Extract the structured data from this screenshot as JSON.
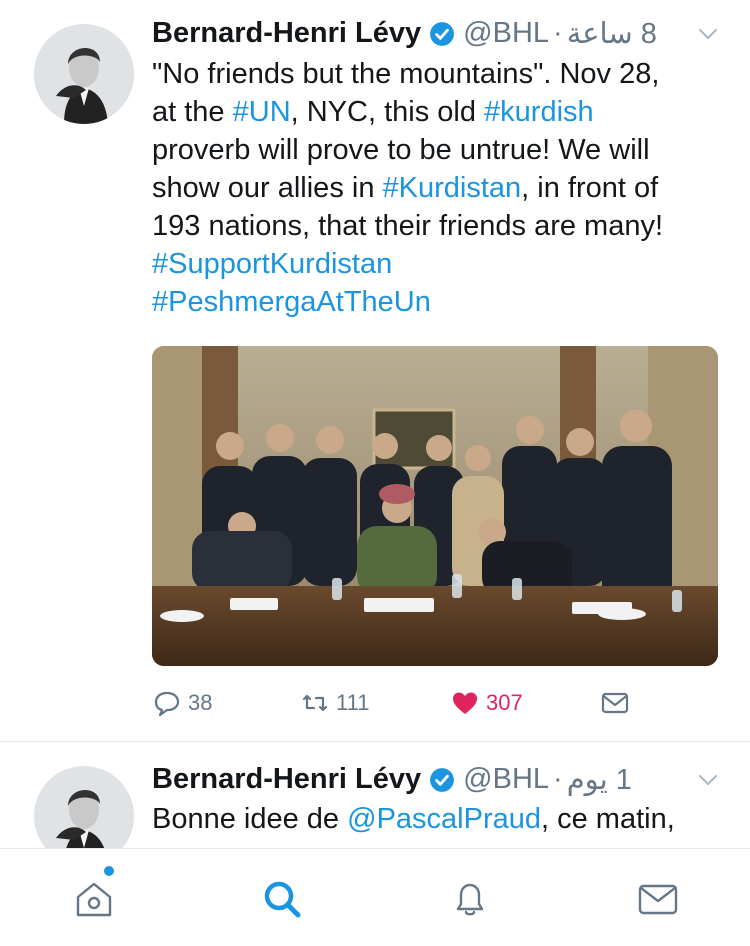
{
  "tweets": [
    {
      "name": "Bernard-Henri Lévy",
      "handle": "@BHL",
      "time": "8 ساعة",
      "text_plain_1": "\"No friends but the mountains\". Nov 28,",
      "line2_a": "at the ",
      "line2_tag1": "#UN",
      "line2_b": ", NYC, this old ",
      "line2_tag2": "#kurdish",
      "line3": "proverb will prove to be untrue! We will",
      "line4_a": "show our allies in ",
      "line4_tag": "#Kurdistan",
      "line4_b": ", in front of",
      "line5": "193 nations, that their friends are many!",
      "tag_support": "#SupportKurdistan",
      "tag_peshmerga": "#PeshmergaAtTheUn",
      "replies": "38",
      "retweets": "111",
      "likes": "307"
    },
    {
      "name": "Bernard-Henri Lévy",
      "handle": "@BHL",
      "time": "1 يوم",
      "text_a": "Bonne idee de ",
      "mention": "@PascalPraud",
      "text_b": ", ce matin,"
    }
  ],
  "icons": {
    "verified": "verified-badge-icon",
    "chevron": "chevron-down-icon",
    "reply": "reply-icon",
    "retweet": "retweet-icon",
    "like": "heart-icon",
    "share": "envelope-icon"
  },
  "colors": {
    "accent": "#1b95e0",
    "like": "#e0245e",
    "muted": "#657786"
  },
  "tabbar": [
    "home-icon",
    "search-icon",
    "notifications-icon",
    "messages-icon"
  ]
}
